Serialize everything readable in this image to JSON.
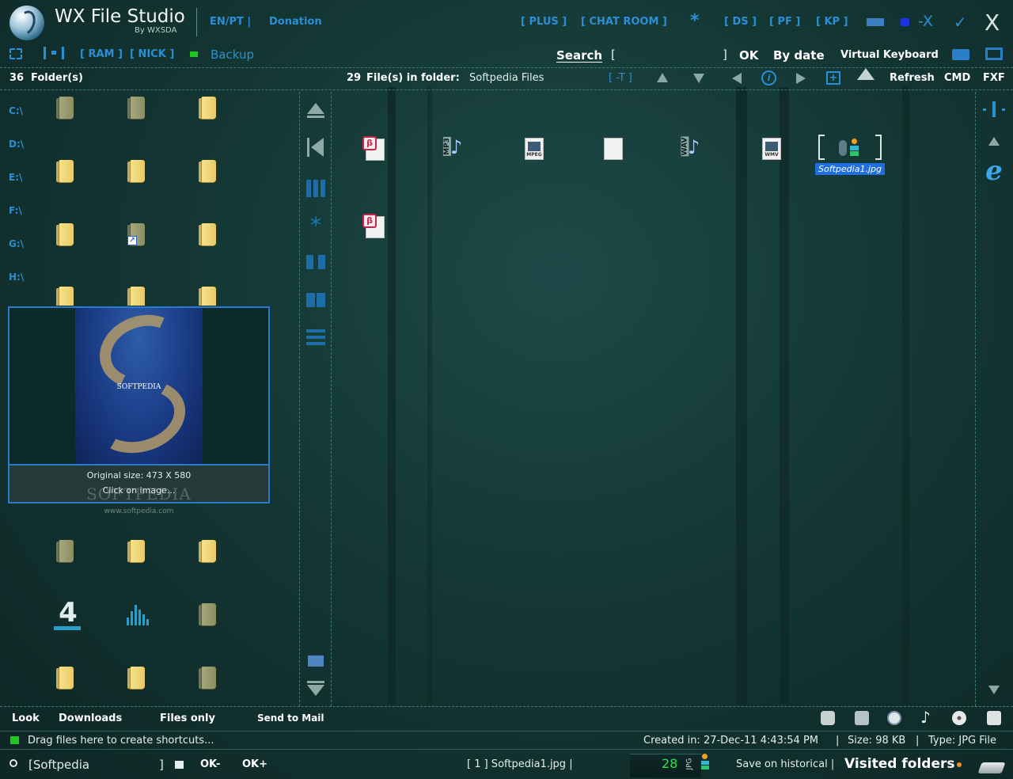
{
  "app": {
    "title": "WX File Studio",
    "subtitle": "By WXSDA",
    "lang": "EN/PT  |",
    "donation": "Donation"
  },
  "top_links": {
    "plus": "[ PLUS ]",
    "chat": "[ CHAT ROOM ]",
    "star": "*",
    "ds": "[ DS ]",
    "pf": "[ PF ]",
    "kp": "[ KP ]",
    "x_mark": "-X",
    "close": "X"
  },
  "toolbar2": {
    "ram": "[ RAM ]",
    "nick": "[ NICK ]",
    "backup": "Backup",
    "search_label": "Search",
    "search_open": "[",
    "search_close": "]",
    "search_value": "",
    "ok": "OK",
    "by_date": "By date",
    "virtual_keyboard": "Virtual Keyboard"
  },
  "infobar": {
    "folder_count": "36",
    "folder_label": "Folder(s)",
    "file_count": "29",
    "file_label": "File(s) in folder:",
    "folder_name": "Softpedia Files",
    "minus_t": "[ -T ]",
    "refresh": "Refresh",
    "cmd": "CMD",
    "fxf": "FXF"
  },
  "drives": [
    "C:\\",
    "D:\\",
    "E:\\",
    "F:\\",
    "G:\\",
    "H:\\"
  ],
  "preview": {
    "original_size": "Original size: 473 X 580",
    "click_hint": "Click on image...",
    "image_text": "SOFTPEDIA",
    "watermark": "SOFTPEDIA",
    "watermark_url": "www.softpedia.com"
  },
  "files": {
    "selected_name": "Softpedia1.jpg",
    "mp3": "MP3",
    "mpeg": "MPEG",
    "wav": "WAV",
    "wmv": "WMV",
    "big_number": "4"
  },
  "bottom_bar": {
    "look": "Look",
    "downloads": "Downloads",
    "files_only": "Files only",
    "send_to_mail": "Send to Mail"
  },
  "status": {
    "drag_hint": "Drag files here to create shortcuts...",
    "created": "Created in: 27-Dec-11 4:43:54 PM",
    "size": "Size: 98 KB",
    "type": "Type: JPG File",
    "sep": "|"
  },
  "footer": {
    "path": "[Softpedia",
    "path_close": "]",
    "ok_minus": "OK-",
    "ok_plus": "OK+",
    "selected_file": "[ 1 ]  Softpedia1.jpg  |",
    "count": "28",
    "jpg": "JPG",
    "save_historical": "Save on historical  |",
    "visited": "Visited folders"
  },
  "colors": {
    "accent_blue": "#2a8fd6",
    "background": "#143734",
    "green_dot": "#1ec81e",
    "selection": "#1f6fe0"
  }
}
